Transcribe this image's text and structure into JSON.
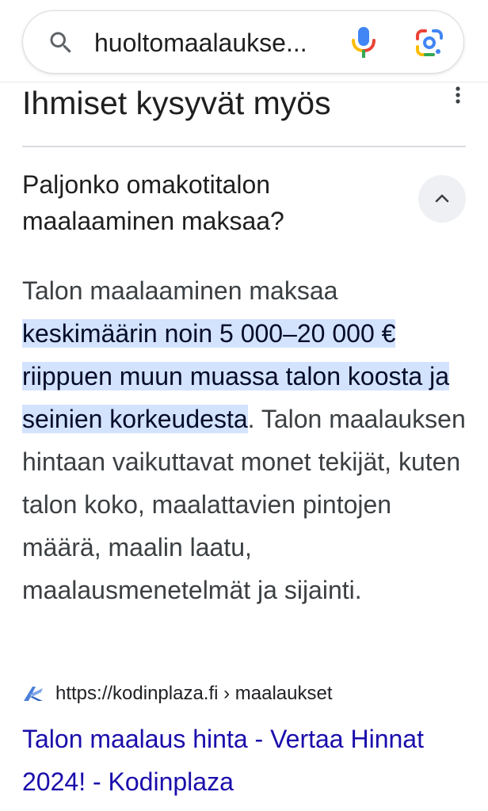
{
  "search": {
    "query": "huoltomaalaukse..."
  },
  "section": {
    "title": "Ihmiset kysyvät myös"
  },
  "question": {
    "text": "Paljonko omakotitalon maalaaminen maksaa?",
    "expanded": true
  },
  "answer": {
    "intro": "Talon maalaaminen maksaa",
    "highlight": "keskimäärin noin 5 000–20 000 € riippuen muun muassa talon koosta ja seinien korkeudesta",
    "after_highlight": ".",
    "rest": "Talon maalauksen hintaan vaikuttavat monet tekijät, kuten talon koko, maalattavien pintojen määrä, maalin laatu, maalausmenetelmät ja sijainti."
  },
  "source": {
    "url": "https://kodinplaza.fi › maalaukset",
    "title": "Talon maalaus hinta - Vertaa Hinnat 2024! - Kodinplaza"
  },
  "icons": {
    "search": "search-icon",
    "voice": "microphone-icon",
    "lens": "google-lens-icon",
    "more": "more-vert-icon",
    "collapse": "chevron-up-icon",
    "site": "kodinplaza-logo-icon"
  },
  "colors": {
    "highlight": "#d3e3fd",
    "link": "#1a0dab",
    "text": "#1f1f1f"
  }
}
